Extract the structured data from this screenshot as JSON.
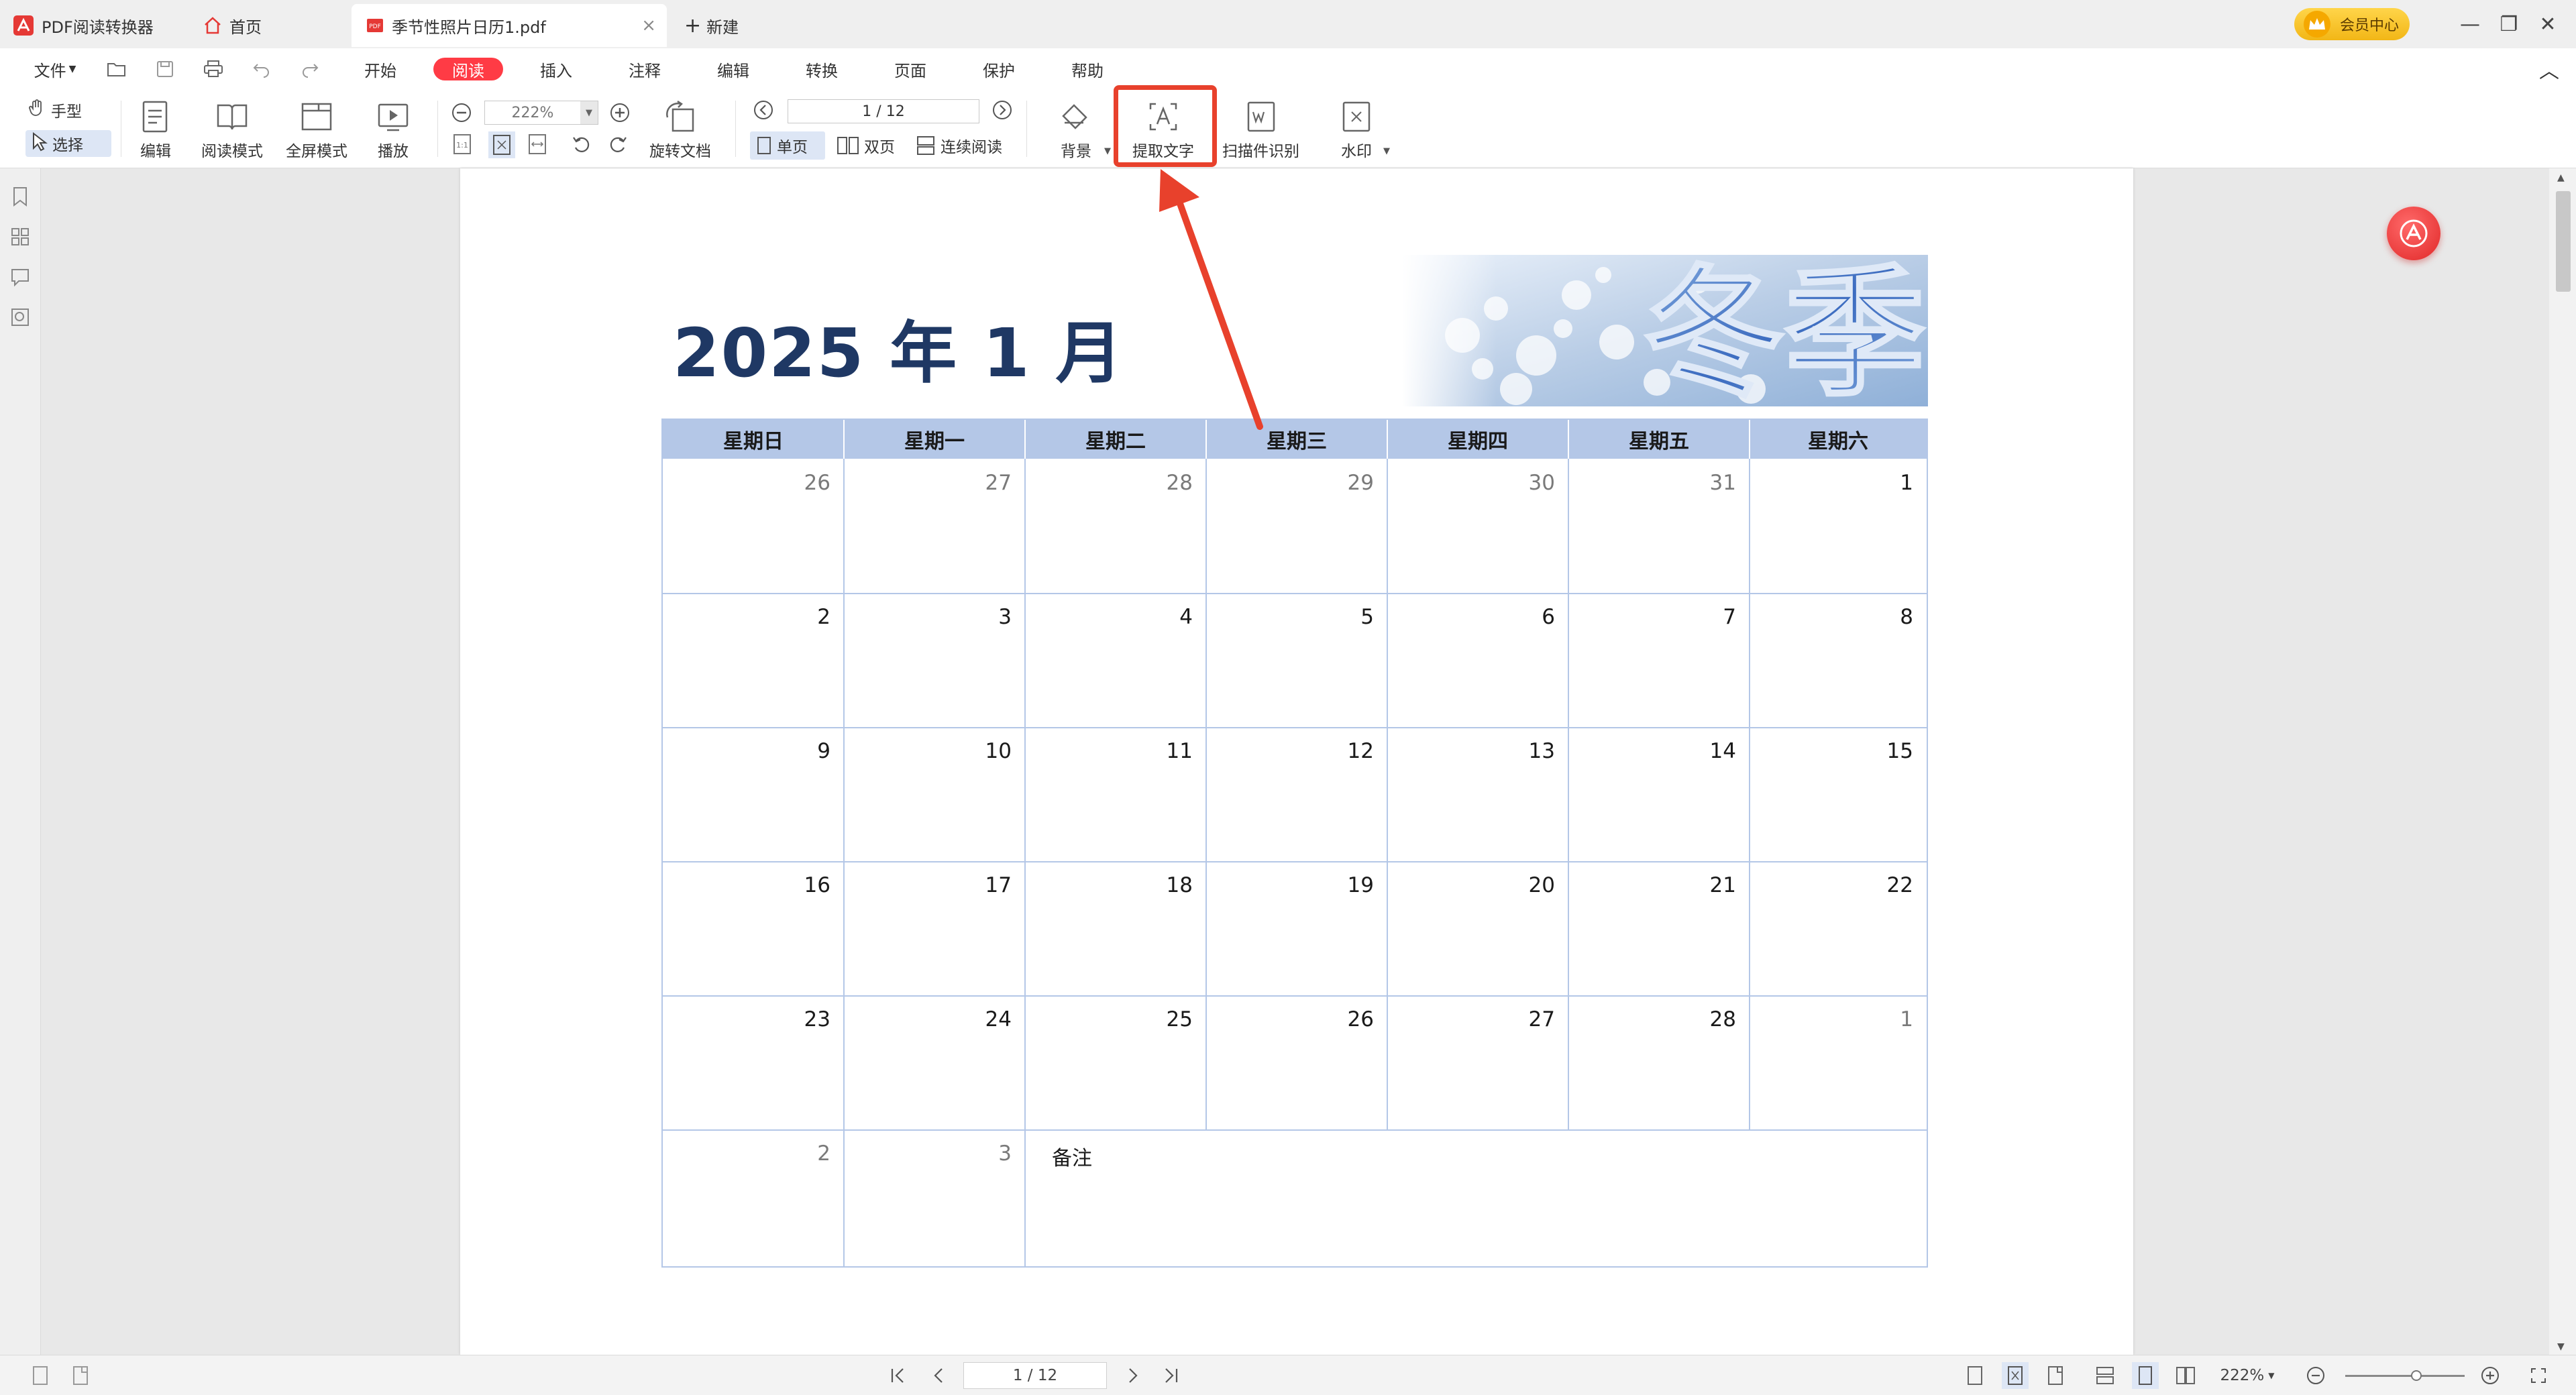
{
  "app": {
    "name": "PDF阅读转换器"
  },
  "tabs": [
    {
      "label": "首页"
    },
    {
      "label": "季节性照片日历1.pdf",
      "close": "×"
    },
    {
      "label": "新建",
      "prefix": "+"
    }
  ],
  "vip": {
    "label": "会员中心"
  },
  "window_controls": {
    "minimize": "—",
    "restore": "❐",
    "close": "✕"
  },
  "menu": {
    "file": "文件",
    "items": [
      "开始",
      "阅读",
      "插入",
      "注释",
      "编辑",
      "转换",
      "页面",
      "保护",
      "帮助"
    ],
    "active_index": 1,
    "collapse": "︿"
  },
  "ribbon": {
    "hand": "手型",
    "select": "选择",
    "edit": "编辑",
    "read_mode": "阅读模式",
    "fullscreen": "全屏模式",
    "play": "播放",
    "zoom": "222%",
    "rotate": "旋转文档",
    "page_input": "1 / 12",
    "single": "单页",
    "double": "双页",
    "continuous": "连续阅读",
    "background": "背景",
    "extract_text": "提取文字",
    "scan_ocr": "扫描件识别",
    "watermark": "水印"
  },
  "document": {
    "title": "2025 年 1 月",
    "banner_text": "冬季",
    "weekdays": [
      "星期日",
      "星期一",
      "星期二",
      "星期三",
      "星期四",
      "星期五",
      "星期六"
    ],
    "weeks": [
      [
        "26",
        "27",
        "28",
        "29",
        "30",
        "31",
        "1"
      ],
      [
        "2",
        "3",
        "4",
        "5",
        "6",
        "7",
        "8"
      ],
      [
        "9",
        "10",
        "11",
        "12",
        "13",
        "14",
        "15"
      ],
      [
        "16",
        "17",
        "18",
        "19",
        "20",
        "21",
        "22"
      ],
      [
        "23",
        "24",
        "25",
        "26",
        "27",
        "28",
        "1"
      ],
      [
        "2",
        "3"
      ]
    ],
    "muted_cells": [
      [
        0,
        0
      ],
      [
        0,
        1
      ],
      [
        0,
        2
      ],
      [
        0,
        3
      ],
      [
        0,
        4
      ],
      [
        0,
        5
      ],
      [
        4,
        6
      ],
      [
        5,
        0
      ],
      [
        5,
        1
      ]
    ],
    "notes_label": "备注"
  },
  "status": {
    "page": "1 / 12",
    "zoom": "222%"
  },
  "colors": {
    "accent": "#ff3b45",
    "header_fill": "#b4c7e7",
    "title_navy": "#1f3864",
    "highlight": "#e8412c"
  }
}
